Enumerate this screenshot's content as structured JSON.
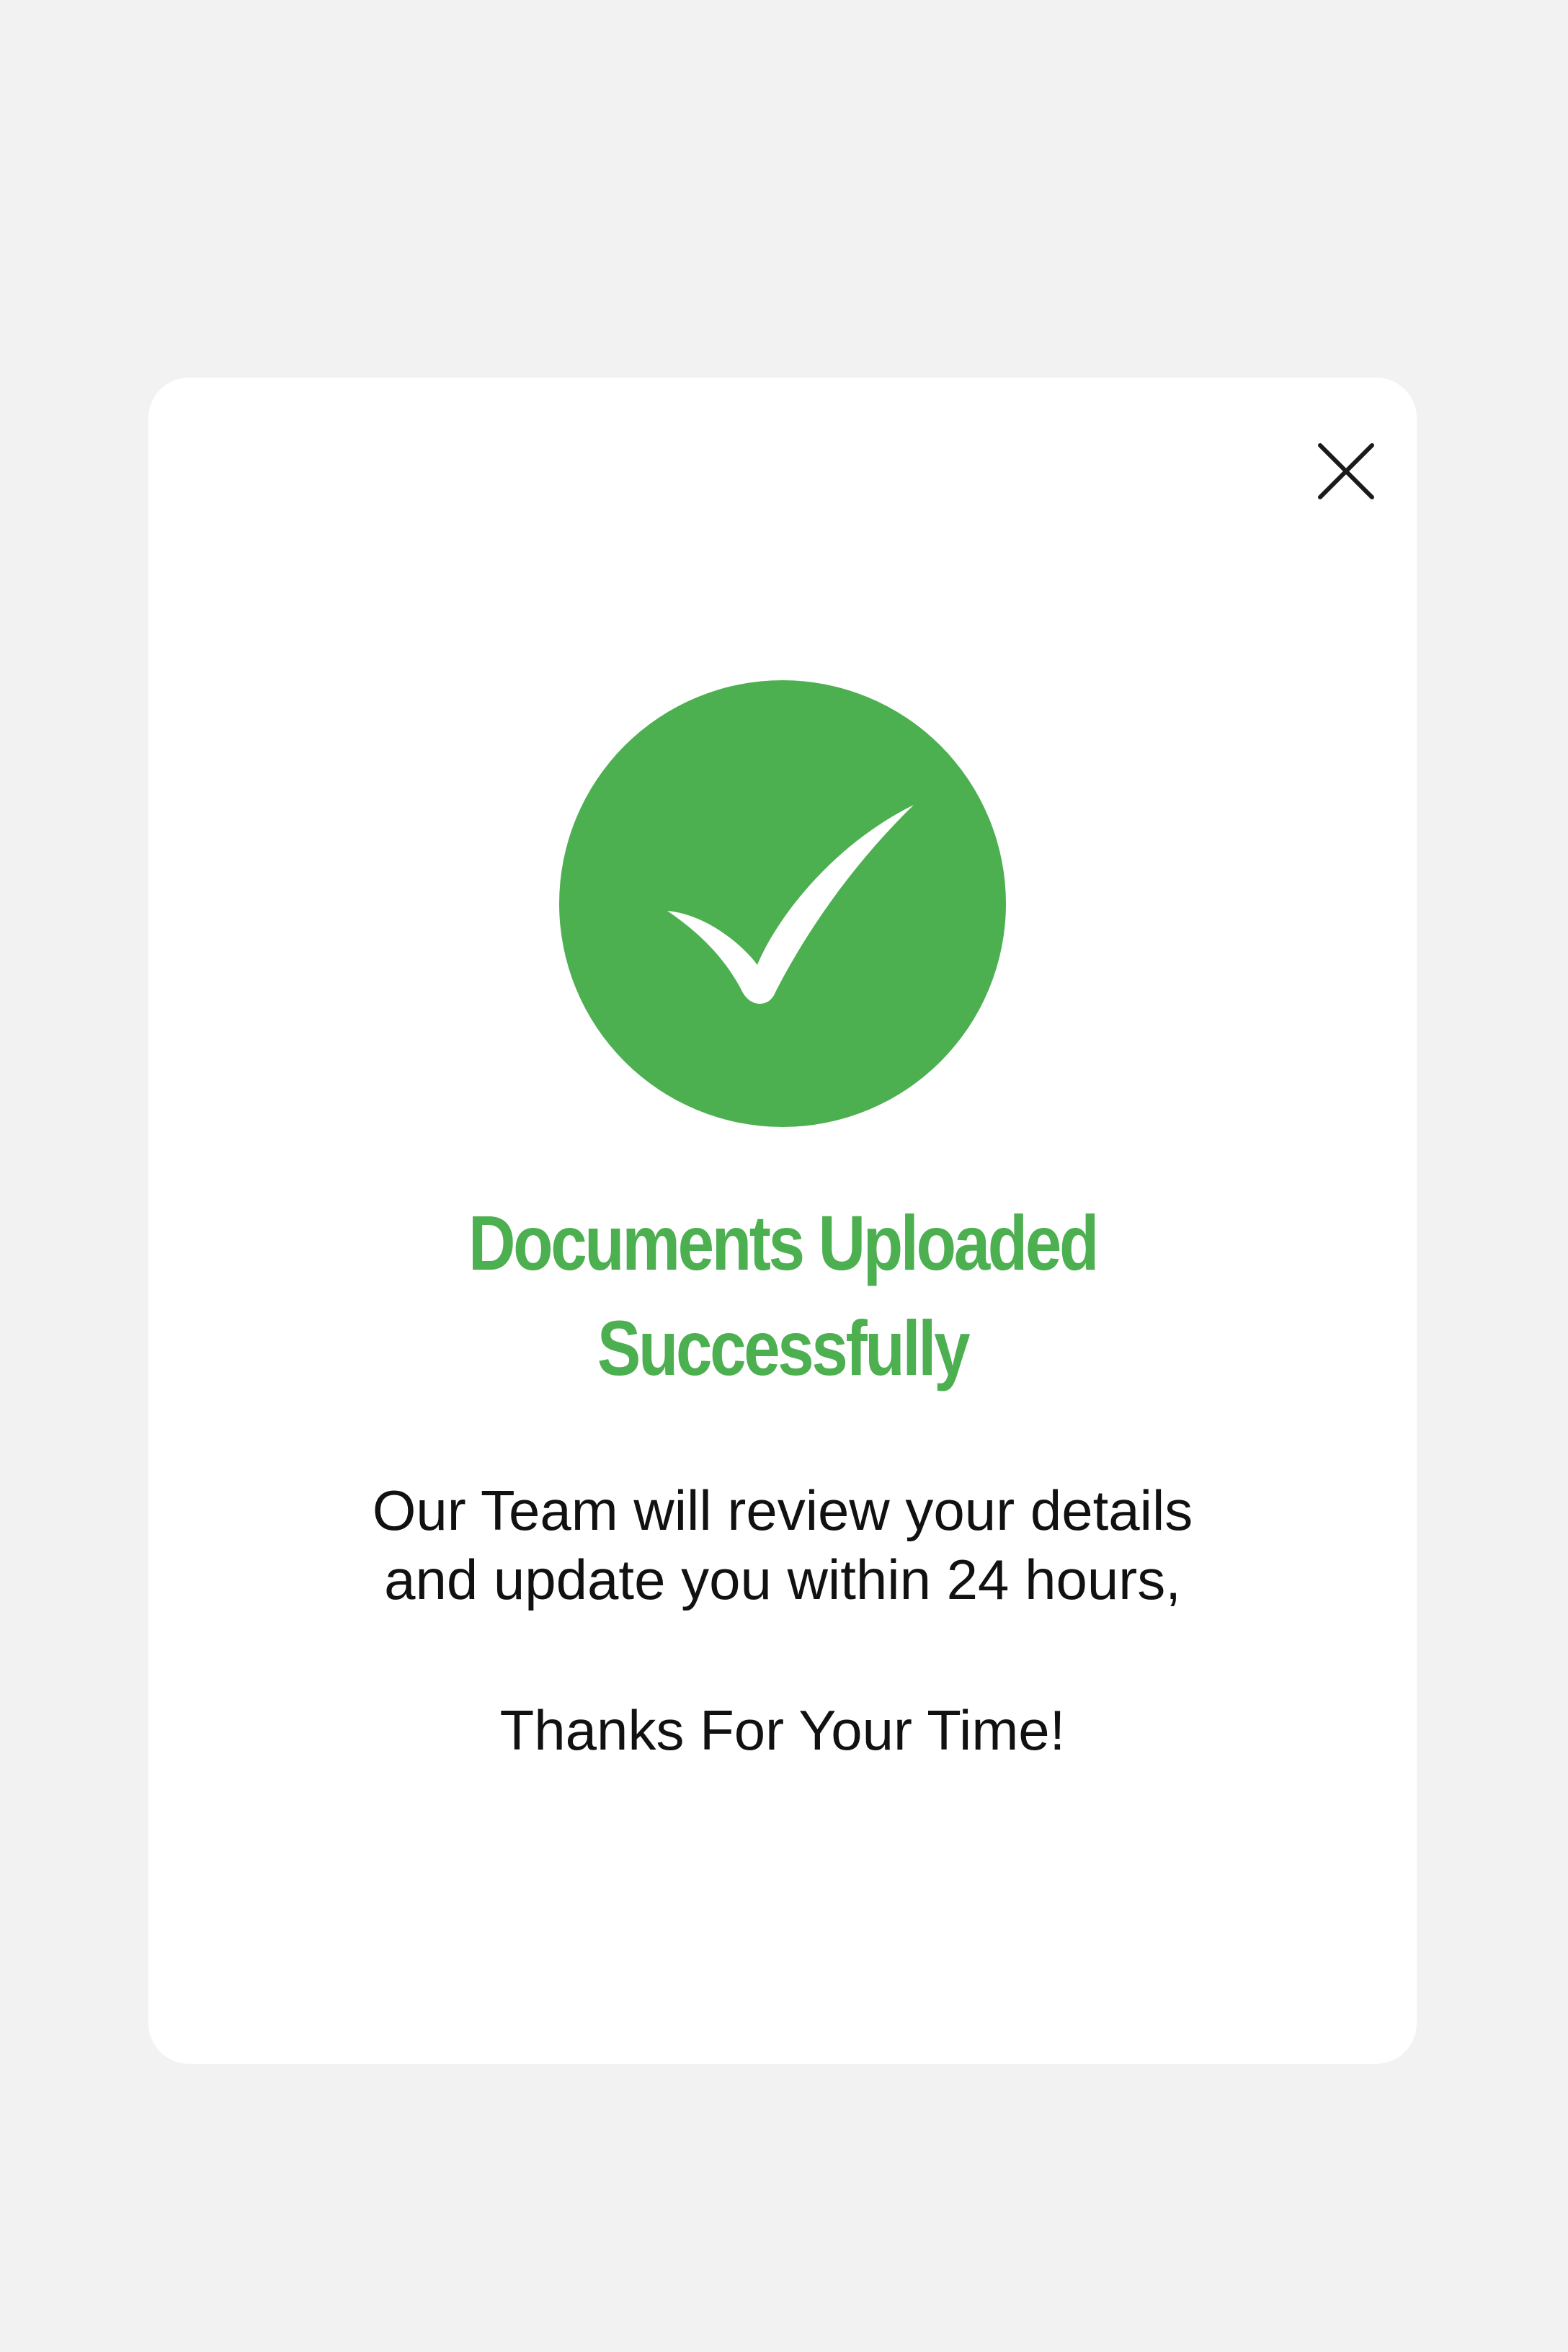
{
  "dialog": {
    "close_icon": "close-icon",
    "success_icon": "check-circle-icon",
    "title": {
      "line1": "Documents Uploaded",
      "line2": "Successfully"
    },
    "message": {
      "line1": "Our Team will review your details",
      "line2": "and update you within 24 hours,"
    },
    "thanks": "Thanks For Your Time!"
  },
  "colors": {
    "background": "#f2f2f2",
    "dialog_background": "#ffffff",
    "accent": "#4caf50",
    "text": "#111111"
  }
}
